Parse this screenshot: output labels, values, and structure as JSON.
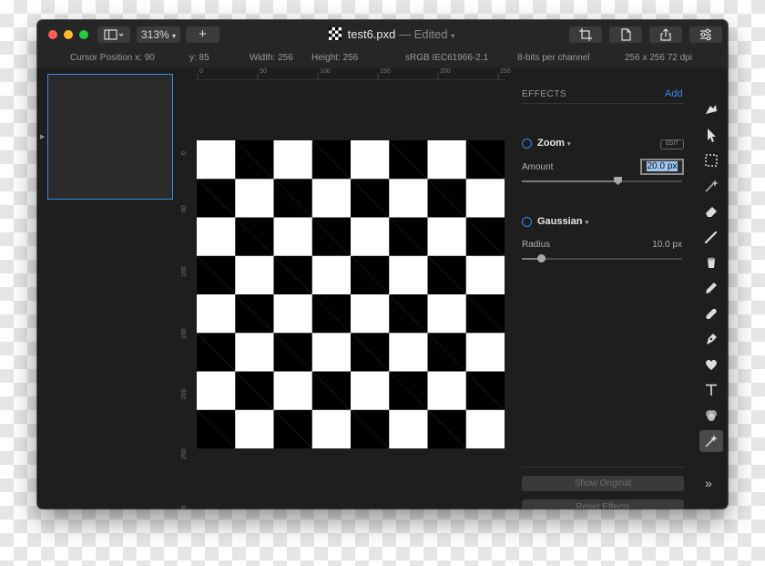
{
  "window": {
    "title": "test6.pxd",
    "title_status": "— Edited",
    "zoom": "313%",
    "new_button": "+"
  },
  "info": {
    "cursor_x": "Cursor Position x: 90",
    "cursor_y": "y: 85",
    "width": "Width: 256",
    "height": "Height: 256",
    "color_profile": "sRGB IEC61966-2.1",
    "bit_depth": "8-bits per channel",
    "dimensions": "256  x 256 72 dpi"
  },
  "rulers": {
    "top": [
      "0",
      "50",
      "100",
      "150",
      "200",
      "250"
    ],
    "left": [
      "0",
      "50",
      "100",
      "150",
      "200",
      "250",
      "300"
    ]
  },
  "effects": {
    "header": "EFFECTS",
    "add_label": "Add",
    "zoom": {
      "name": "Zoom",
      "edit_label": "EDIT",
      "param_label": "Amount",
      "value": "20.0 px",
      "slider_level": 0.6
    },
    "gaussian": {
      "name": "Gaussian",
      "param_label": "Radius",
      "value": "10.0 px",
      "slider_level": 0.12
    },
    "show_original": "Show Original",
    "reset_effects": "Reset Effects"
  },
  "tools": [
    "smudge-icon",
    "pointer-icon",
    "marquee-select-icon",
    "magic-wand-icon",
    "eraser-icon",
    "brush-icon",
    "bucket-icon",
    "pencil-icon",
    "bandage-icon",
    "pen-icon",
    "heart-shape-icon",
    "text-icon",
    "color-adjust-icon",
    "effects-icon"
  ],
  "more_tools": "»",
  "colors": {
    "accent": "#3a8ae8",
    "window_bg": "#1e1e1e",
    "traffic_red": "#fe5f57",
    "traffic_yellow": "#febc2e",
    "traffic_green": "#28c840"
  }
}
